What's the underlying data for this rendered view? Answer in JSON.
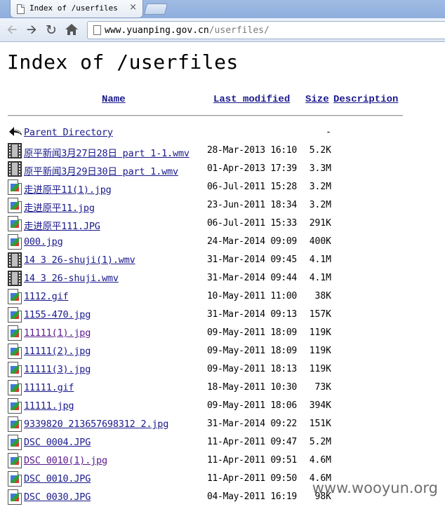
{
  "browser": {
    "tab_title": "Index of /userfiles",
    "tab_close": "×",
    "url_host": "www.yuanping.gov.cn",
    "url_path": "/userfiles/"
  },
  "page": {
    "title": "Index of /userfiles",
    "columns": {
      "name": "Name",
      "last_modified": "Last modified",
      "size": "Size",
      "description": "Description"
    },
    "parent": {
      "name": "Parent Directory",
      "size": "-"
    },
    "files": [
      {
        "name": "原平新闻3月27日28日 part 1-1.wmv",
        "modified": "28-Mar-2013 16:10",
        "size": "5.2K",
        "icon": "video-icon"
      },
      {
        "name": "原平新闻3月29日30日 part 1.wmv",
        "modified": "01-Apr-2013 17:39",
        "size": "3.3M",
        "icon": "video-icon"
      },
      {
        "name": "走进原平11(1).jpg",
        "modified": "06-Jul-2011 15:28",
        "size": "3.2M",
        "icon": "image-icon"
      },
      {
        "name": "走进原平11.jpg",
        "modified": "23-Jun-2011 18:34",
        "size": "3.2M",
        "icon": "image-icon"
      },
      {
        "name": "走进原平111.JPG",
        "modified": "06-Jul-2011 15:33",
        "size": "291K",
        "icon": "image-icon"
      },
      {
        "name": "000.jpg",
        "modified": "24-Mar-2014 09:09",
        "size": "400K",
        "icon": "image-icon"
      },
      {
        "name": "14 3 26-shuji(1).wmv",
        "modified": "31-Mar-2014 09:45",
        "size": "4.1M",
        "icon": "video-icon"
      },
      {
        "name": "14 3 26-shuji.wmv",
        "modified": "31-Mar-2014 09:44",
        "size": "4.1M",
        "icon": "video-icon"
      },
      {
        "name": "1112.gif",
        "modified": "10-May-2011 11:00",
        "size": "38K",
        "icon": "image-icon"
      },
      {
        "name": "1155-470.jpg",
        "modified": "31-Mar-2014 09:13",
        "size": "157K",
        "icon": "image-icon"
      },
      {
        "name": "11111(1).jpg",
        "modified": "09-May-2011 18:09",
        "size": "119K",
        "icon": "image-icon",
        "visited": true
      },
      {
        "name": "11111(2).jpg",
        "modified": "09-May-2011 18:09",
        "size": "119K",
        "icon": "image-icon"
      },
      {
        "name": "11111(3).jpg",
        "modified": "09-May-2011 18:13",
        "size": "119K",
        "icon": "image-icon"
      },
      {
        "name": "11111.gif",
        "modified": "18-May-2011 10:30",
        "size": "73K",
        "icon": "image-icon"
      },
      {
        "name": "11111.jpg",
        "modified": "09-May-2011 18:06",
        "size": "394K",
        "icon": "image-icon"
      },
      {
        "name": "9339820 213657698312 2.jpg",
        "modified": "31-Mar-2014 09:22",
        "size": "151K",
        "icon": "image-icon"
      },
      {
        "name": "DSC 0004.JPG",
        "modified": "11-Apr-2011 09:47",
        "size": "5.2M",
        "icon": "image-icon"
      },
      {
        "name": "DSC 0010(1).jpg",
        "modified": "11-Apr-2011 09:51",
        "size": "4.6M",
        "icon": "image-icon",
        "visited": true
      },
      {
        "name": "DSC 0010.JPG",
        "modified": "11-Apr-2011 09:50",
        "size": "4.6M",
        "icon": "image-icon"
      },
      {
        "name": "DSC 0030.JPG",
        "modified": "04-May-2011 16:19",
        "size": "98K",
        "icon": "image-icon"
      }
    ]
  },
  "watermark": "www.wooyun.org"
}
